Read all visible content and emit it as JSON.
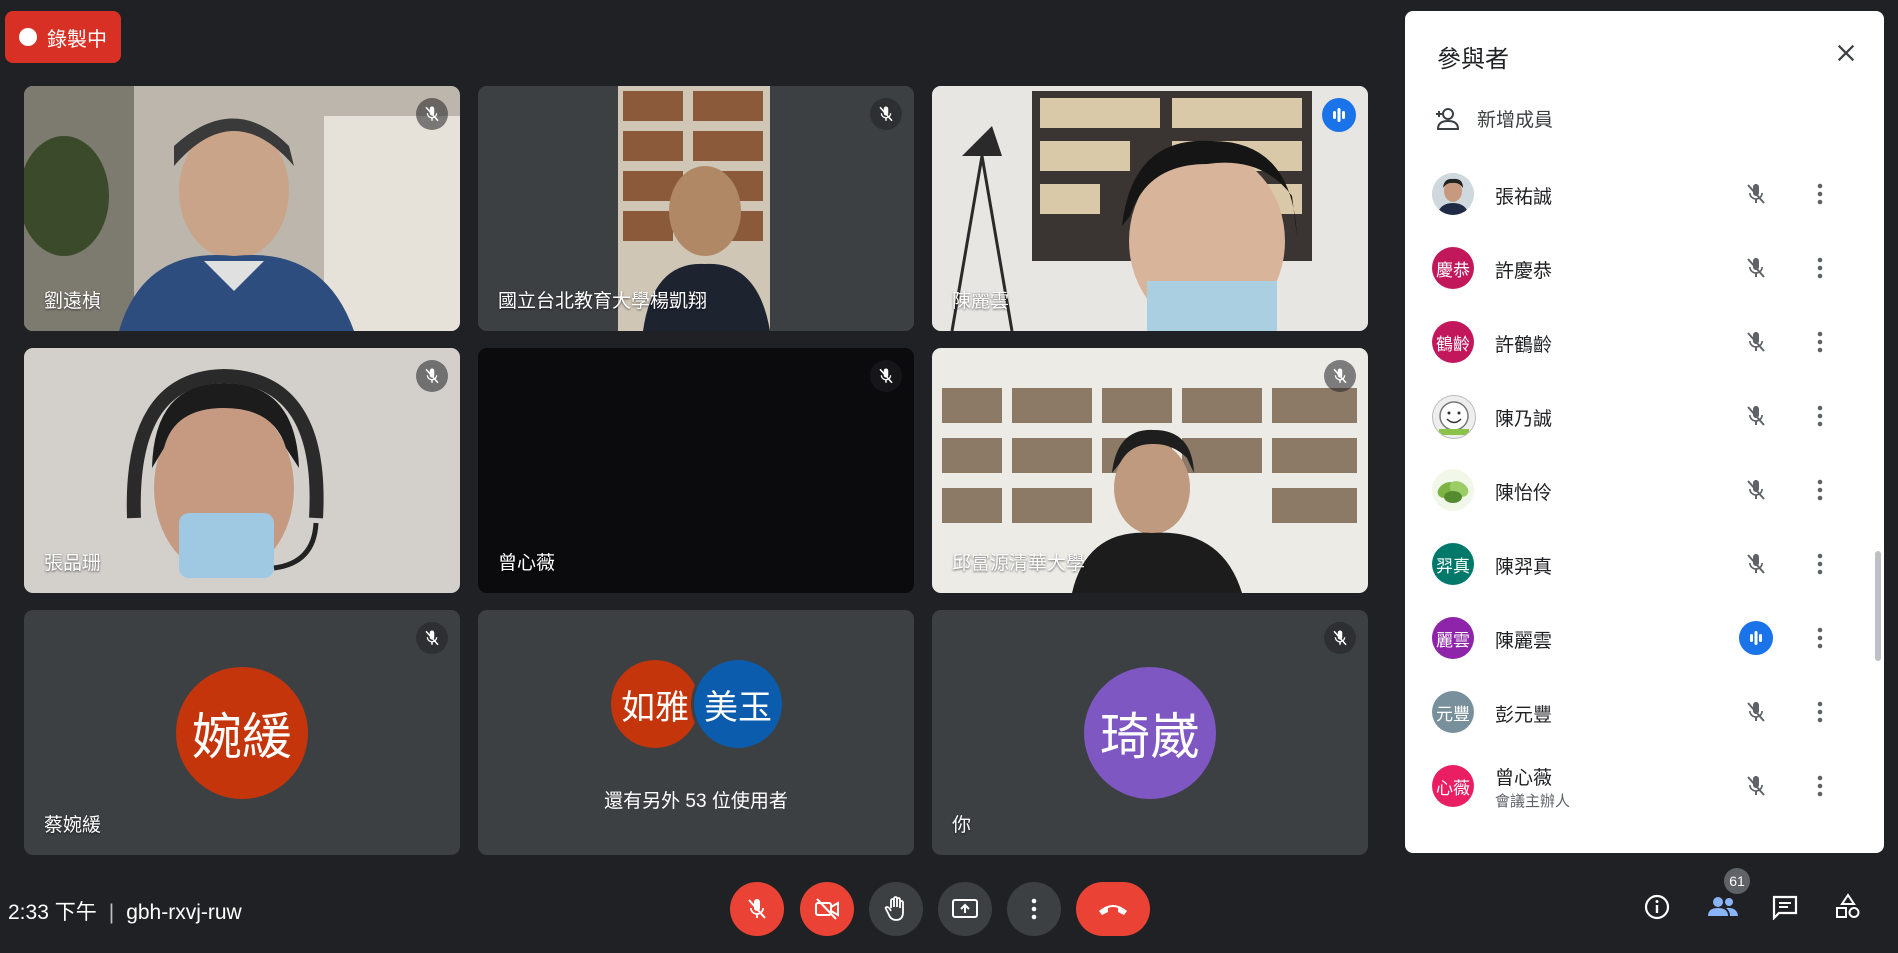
{
  "recording": {
    "label": "錄製中"
  },
  "tiles": [
    {
      "name": "劉遠楨",
      "muted": true
    },
    {
      "name": "國立台北教育大學楊凱翔",
      "muted": true
    },
    {
      "name": "陳麗雲",
      "speaking": true
    },
    {
      "name": "張品珊",
      "muted": true
    },
    {
      "name": "曾心薇",
      "muted": true
    },
    {
      "name": "邱富源清華大學",
      "muted": true
    },
    {
      "name": "蔡婉緩",
      "avatar": "婉緩",
      "avatar_color": "#c5350b",
      "muted": true
    },
    {
      "avatars": [
        {
          "text": "如雅",
          "color": "#c5350b"
        },
        {
          "text": "美玉",
          "color": "#0b5cad"
        }
      ],
      "more_label": "還有另外 53 位使用者"
    },
    {
      "name": "你",
      "avatar": "琦崴",
      "avatar_color": "#7e57c2",
      "muted": true
    }
  ],
  "bottom": {
    "time": "2:33 下午",
    "meeting_code": "gbh-rxvj-ruw",
    "people_count": "61"
  },
  "panel": {
    "title": "參與者",
    "add_member": "新增成員",
    "participants": [
      {
        "name": "張祐誠",
        "avatar_type": "photo",
        "state": "muted"
      },
      {
        "name": "許慶恭",
        "avatar": "慶恭",
        "color": "#c2185b",
        "state": "muted"
      },
      {
        "name": "許鶴齡",
        "avatar": "鶴齡",
        "color": "#c2185b",
        "state": "muted"
      },
      {
        "name": "陳乃誠",
        "avatar_type": "smiley",
        "state": "muted"
      },
      {
        "name": "陳怡伶",
        "avatar_type": "leaf",
        "state": "muted"
      },
      {
        "name": "陳羿真",
        "avatar": "羿真",
        "color": "#00796b",
        "state": "muted"
      },
      {
        "name": "陳麗雲",
        "avatar": "麗雲",
        "color": "#8e24aa",
        "state": "speaking"
      },
      {
        "name": "彭元豐",
        "avatar": "元豐",
        "color": "#78909c",
        "state": "muted"
      },
      {
        "name": "曾心薇",
        "avatar": "心薇",
        "color": "#e91e63",
        "state": "muted",
        "sub": "會議主辦人"
      }
    ]
  },
  "colors": {
    "accent": "#1a73e8",
    "danger": "#ea4335",
    "recording": "#d93025",
    "tile": "#3c4043",
    "background": "#202124"
  }
}
